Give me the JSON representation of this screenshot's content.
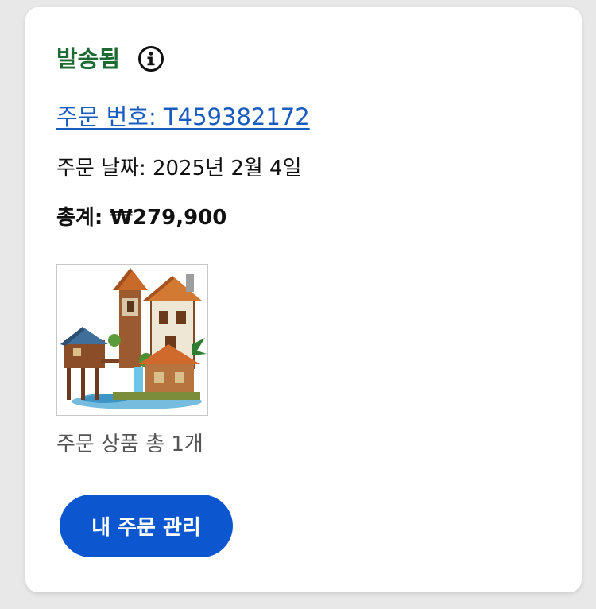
{
  "order": {
    "status": "발송됨",
    "number_label": "주문 번호: T459382172",
    "date_label": "주문 날짜: 2025년 2월 4일",
    "total_label": "총계: ₩279,900",
    "item_count_label": "주문 상품 총 1개",
    "manage_button_label": "내 주문 관리"
  },
  "icons": {
    "info": "info-icon",
    "product": "product-thumbnail-image"
  },
  "colors": {
    "status": "#1d6b32",
    "link": "#1a5bbf",
    "button": "#0c56cf"
  }
}
